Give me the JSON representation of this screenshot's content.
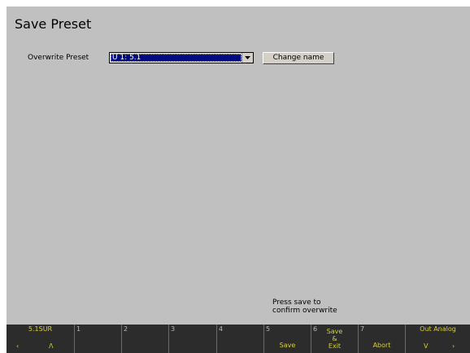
{
  "title": "Save Preset",
  "overwrite": {
    "label": "Overwrite Preset",
    "selected": "U 1: 5.1",
    "change_name_label": "Change name"
  },
  "hint": {
    "line1": "Press save to",
    "line2": "confirm overwrite"
  },
  "softkeys": {
    "left": {
      "label": "5.1SUR",
      "prev": "‹",
      "up": "Λ"
    },
    "k1": {
      "num": "1"
    },
    "k2": {
      "num": "2"
    },
    "k3": {
      "num": "3"
    },
    "k4": {
      "num": "4"
    },
    "k5": {
      "num": "5",
      "label": "Save"
    },
    "k6": {
      "num": "6",
      "line1": "Save",
      "line2": "&",
      "line3": "Exit"
    },
    "k7": {
      "num": "7",
      "label": "Abort"
    },
    "right": {
      "label": "Out Analog",
      "down": "V",
      "next": "›"
    }
  },
  "colors": {
    "background": "#c0c0c0",
    "softbar": "#2c2c2c",
    "softkey_text": "#d8d030",
    "selection": "#000a80"
  }
}
